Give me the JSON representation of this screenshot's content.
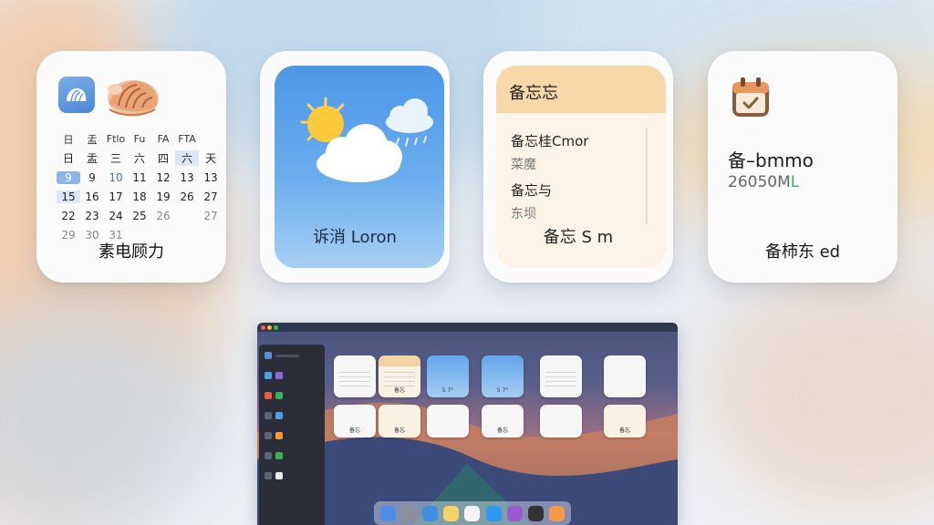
{
  "calendar_widget": {
    "weekdays": [
      "日",
      "盂",
      "Ftlo",
      "Fu",
      "FA",
      "FTA"
    ],
    "weekdays_row2": [
      "日",
      "盂",
      "三",
      "六",
      "四",
      "六",
      "天"
    ],
    "rows": [
      [
        "9",
        "9",
        "10",
        "11",
        "12",
        "13",
        "13"
      ],
      [
        "15",
        "16",
        "17",
        "18",
        "19",
        "26",
        "27"
      ],
      [
        "22",
        "23",
        "24",
        "25",
        "26",
        "",
        "27"
      ],
      [
        "29",
        "30",
        "31"
      ]
    ],
    "label": "素电顾力"
  },
  "weather_widget": {
    "label": "诉消 Loron"
  },
  "notes_widget": {
    "header": "备忘忘",
    "line1": "备忘桂Cmor",
    "line2": "菜魔",
    "line3": "备忘与",
    "line4": "东坝",
    "label": "备忘 S m"
  },
  "reminders_widget": {
    "title": "备–bmmo",
    "subtitle": "26050M",
    "subtitle_suffix": "L",
    "label": "备柿东 ed"
  },
  "screenshot": {
    "mini_widget_labels": [
      "备忘",
      "5 7°",
      "5 7°",
      "备忘",
      "备忘",
      "备忘",
      "备忘"
    ]
  },
  "colors": {
    "calendar_icon": "#5a8fd9",
    "weather_bg": "#5aa0ea",
    "notes_header": "#f8d7a9",
    "reminder_icon": "#e8965c",
    "accent_green": "#3ab05a"
  }
}
